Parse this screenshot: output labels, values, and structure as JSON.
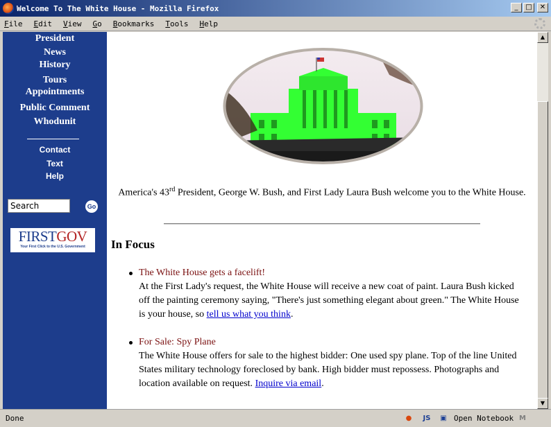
{
  "window": {
    "title": "Welcome To The White House - Mozilla Firefox",
    "minimize": "_",
    "maximize": "□",
    "close": "✕"
  },
  "menu": [
    "File",
    "Edit",
    "View",
    "Go",
    "Bookmarks",
    "Tools",
    "Help"
  ],
  "sidebar": {
    "nav": [
      "President",
      "News",
      "History",
      "Tours",
      "Appointments",
      "Public Comment",
      "Whodunit"
    ],
    "secondary": [
      "Contact",
      "Text",
      "Help"
    ],
    "search_value": "Search",
    "go_label": "Go",
    "logo_main_first": "FIRST",
    "logo_main_gov": "GOV",
    "logo_tagline": "Your First Click to the U.S. Government"
  },
  "main": {
    "welcome_pre": "America's 43",
    "welcome_sup": "rd",
    "welcome_post": " President, George W. Bush, and First Lady Laura Bush welcome you to the White House.",
    "focus_heading": "In Focus",
    "items": [
      {
        "title": "The White House gets a facelift!",
        "body": "At the First Lady's request, the White House will receive a new coat of paint. Laura Bush kicked off the painting ceremony saying, \"There's just something elegant about green.\" The White House is your house, so ",
        "link": "tell us what you think",
        "tail": "."
      },
      {
        "title": "For Sale: Spy Plane",
        "body": "The White House offers for sale to the highest bidder: One used spy plane. Top of the line United States military technology foreclosed by bank. High bidder must repossess. Photographs and location available on request. ",
        "link": "Inquire via email",
        "tail": "."
      }
    ]
  },
  "statusbar": {
    "status": "Done",
    "notebook": "Open Notebook"
  },
  "colors": {
    "sidebar": "#1d3d8c",
    "item_title": "#7a1010",
    "link": "#0000cc"
  }
}
